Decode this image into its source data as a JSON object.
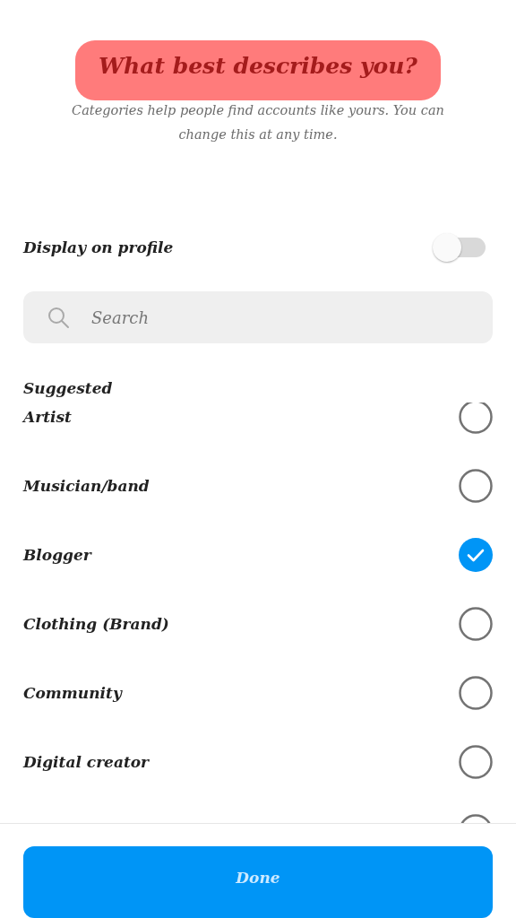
{
  "title": "What best describes you?",
  "subtitle": "Categories help people find accounts like yours. You can change this at any time.",
  "display_on_profile": {
    "label": "Display on profile",
    "on": false
  },
  "search": {
    "placeholder": "Search"
  },
  "section": "Suggested",
  "categories": [
    {
      "label": "Artist",
      "selected": false
    },
    {
      "label": "Musician/band",
      "selected": false
    },
    {
      "label": "Blogger",
      "selected": true
    },
    {
      "label": "Clothing (Brand)",
      "selected": false
    },
    {
      "label": "Community",
      "selected": false
    },
    {
      "label": "Digital creator",
      "selected": false
    },
    {
      "selected": false
    }
  ],
  "done_button": "Done"
}
